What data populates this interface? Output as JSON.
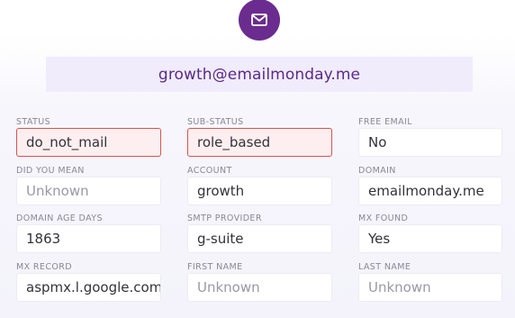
{
  "header": {
    "icon": "mail-envelope-icon",
    "badge_color": "#6a2c8e",
    "email": "growth@emailmonday.me"
  },
  "fields": [
    {
      "label": "STATUS",
      "value": "do_not_mail",
      "state": "alert"
    },
    {
      "label": "SUB-STATUS",
      "value": "role_based",
      "state": "alert"
    },
    {
      "label": "FREE EMAIL",
      "value": "No",
      "state": "normal"
    },
    {
      "label": "DID YOU MEAN",
      "value": "Unknown",
      "state": "muted"
    },
    {
      "label": "ACCOUNT",
      "value": "growth",
      "state": "normal"
    },
    {
      "label": "DOMAIN",
      "value": "emailmonday.me",
      "state": "normal"
    },
    {
      "label": "DOMAIN AGE DAYS",
      "value": "1863",
      "state": "normal"
    },
    {
      "label": "SMTP PROVIDER",
      "value": "g-suite",
      "state": "normal"
    },
    {
      "label": "MX FOUND",
      "value": "Yes",
      "state": "normal"
    },
    {
      "label": "MX RECORD",
      "value": "aspmx.l.google.com",
      "state": "normal"
    },
    {
      "label": "FIRST NAME",
      "value": "Unknown",
      "state": "muted"
    },
    {
      "label": "LAST NAME",
      "value": "Unknown",
      "state": "muted"
    }
  ],
  "colors": {
    "accent": "#6a2c8e",
    "banner_text": "#5b2a86",
    "banner_bg": "#f0ecfb",
    "alert_border": "#d9534f",
    "alert_bg": "#fdeef0"
  }
}
